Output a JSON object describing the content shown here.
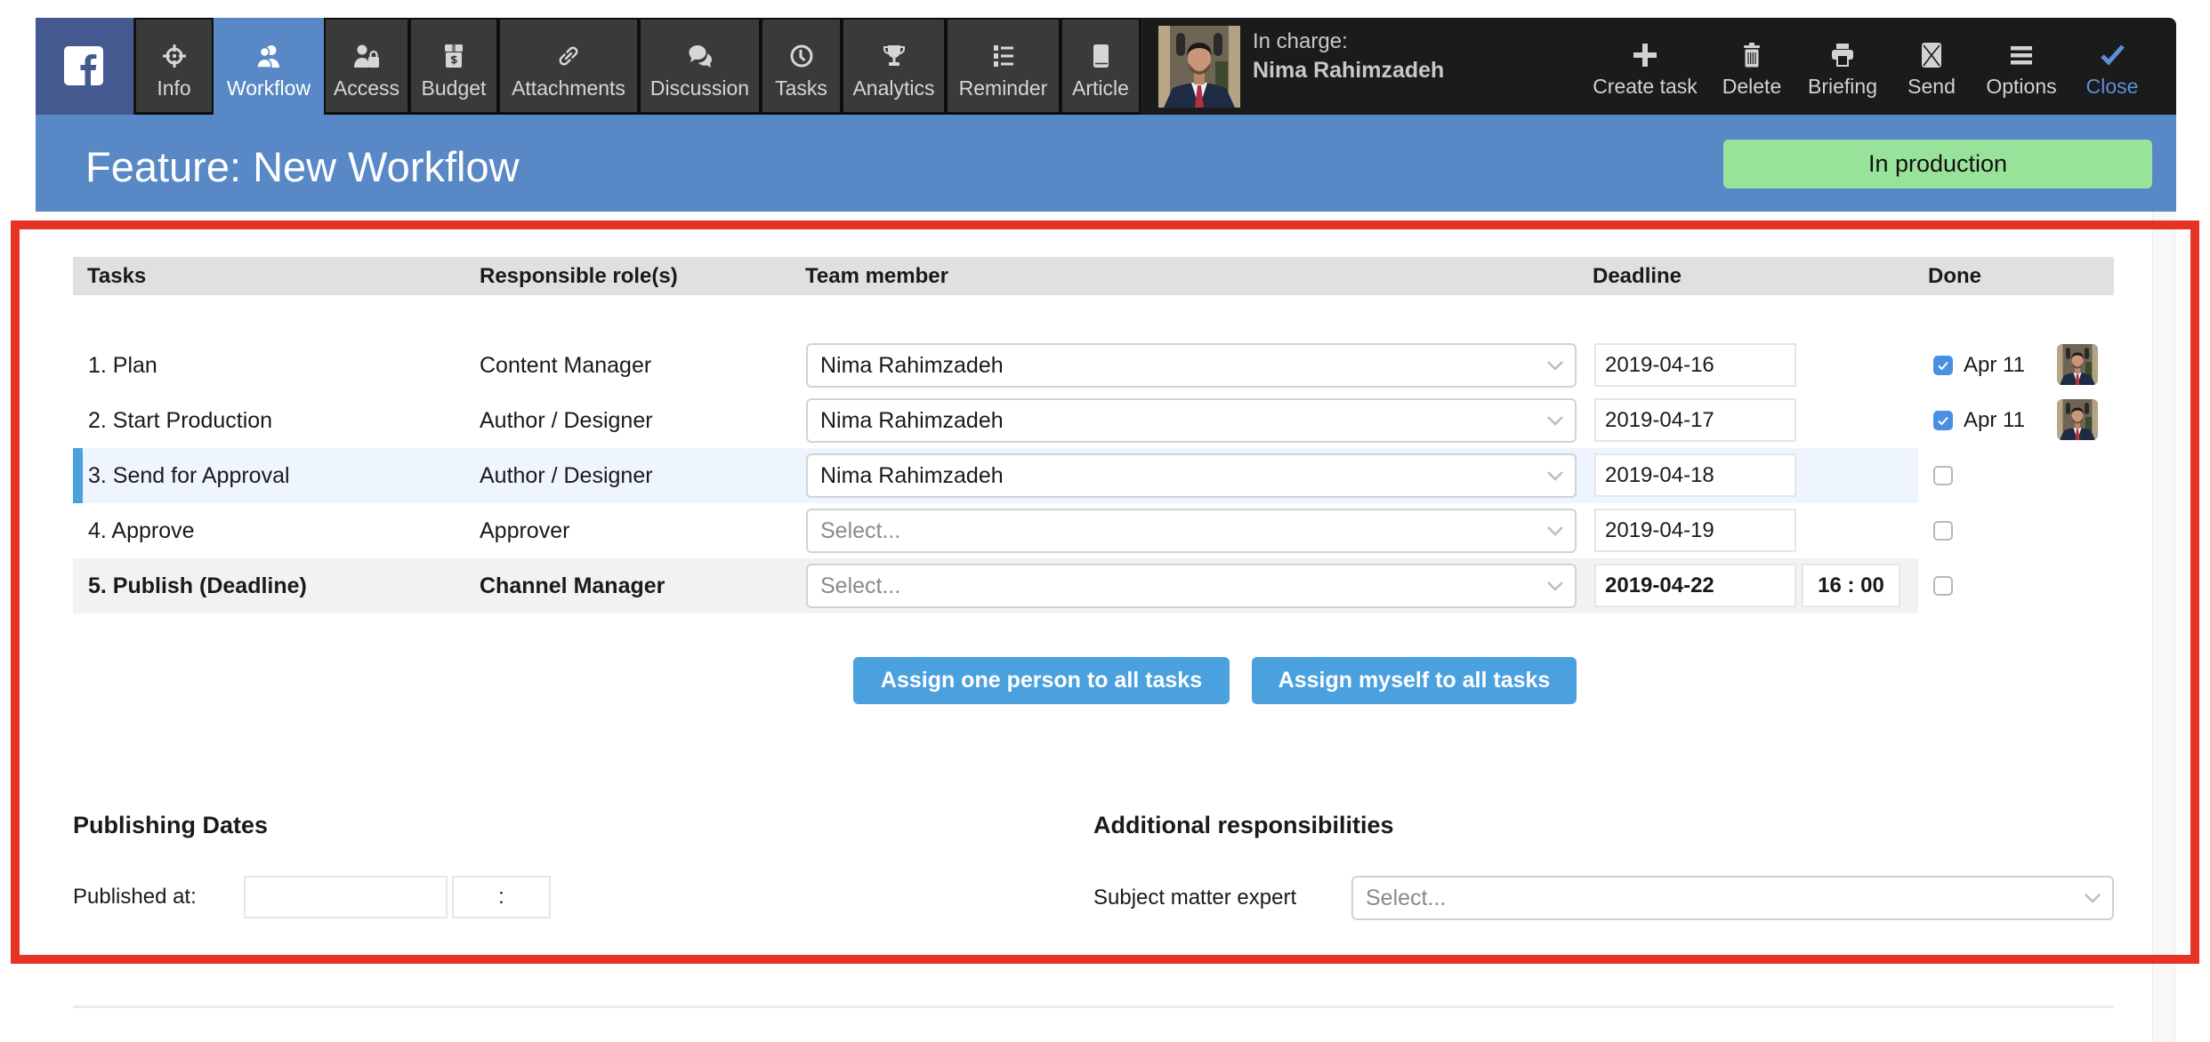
{
  "colors": {
    "brand": "#44598f",
    "toolbar": "#1b1b1b",
    "accent": "#5889c6",
    "status": "#98e39a",
    "button": "#4ba0de",
    "close": "#5b8fd6",
    "annotation": "#e63323"
  },
  "toolbar": {
    "brand_icon": "facebook-icon",
    "tabs": [
      {
        "label": "Info",
        "icon": "target-icon",
        "active": false
      },
      {
        "label": "Workflow",
        "icon": "users-icon",
        "active": true
      },
      {
        "label": "Access",
        "icon": "user-lock-icon",
        "active": false
      },
      {
        "label": "Budget",
        "icon": "money-box-icon",
        "active": false
      },
      {
        "label": "Attachments",
        "icon": "link-icon",
        "active": false
      },
      {
        "label": "Discussion",
        "icon": "comments-icon",
        "active": false
      },
      {
        "label": "Tasks",
        "icon": "clock-icon",
        "active": false
      },
      {
        "label": "Analytics",
        "icon": "trophy-icon",
        "active": false
      },
      {
        "label": "Reminder",
        "icon": "list-icon",
        "active": false
      },
      {
        "label": "Article",
        "icon": "book-icon",
        "active": false
      }
    ],
    "in_charge": {
      "label": "In charge:",
      "name": "Nima Rahimzadeh"
    },
    "actions": [
      {
        "label": "Create task",
        "icon": "plus-icon"
      },
      {
        "label": "Delete",
        "icon": "trash-icon"
      },
      {
        "label": "Briefing",
        "icon": "printer-icon"
      },
      {
        "label": "Send",
        "icon": "envelope-icon"
      },
      {
        "label": "Options",
        "icon": "menu-icon"
      },
      {
        "label": "Close",
        "icon": "check-icon"
      }
    ]
  },
  "header": {
    "title": "Feature: New Workflow",
    "status": "In production"
  },
  "tasks_table": {
    "columns": [
      "Tasks",
      "Responsible role(s)",
      "Team member",
      "Deadline",
      "Done"
    ],
    "member_placeholder": "Select...",
    "rows": [
      {
        "task": "1. Plan",
        "role": "Content Manager",
        "team_member": "Nima Rahimzadeh",
        "deadline": "2019-04-16",
        "deadline_time": null,
        "done": true,
        "done_date": "Apr 11",
        "current": false,
        "emphasized": false
      },
      {
        "task": "2. Start Production",
        "role": "Author / Designer",
        "team_member": "Nima Rahimzadeh",
        "deadline": "2019-04-17",
        "deadline_time": null,
        "done": true,
        "done_date": "Apr 11",
        "current": false,
        "emphasized": false
      },
      {
        "task": "3. Send for Approval",
        "role": "Author / Designer",
        "team_member": "Nima Rahimzadeh",
        "deadline": "2019-04-18",
        "deadline_time": null,
        "done": false,
        "done_date": null,
        "current": true,
        "emphasized": false
      },
      {
        "task": "4. Approve",
        "role": "Approver",
        "team_member": "",
        "deadline": "2019-04-19",
        "deadline_time": null,
        "done": false,
        "done_date": null,
        "current": false,
        "emphasized": false
      },
      {
        "task": "5. Publish (Deadline)",
        "role": "Channel Manager",
        "team_member": "",
        "deadline": "2019-04-22",
        "deadline_time": "16 : 00",
        "done": false,
        "done_date": null,
        "current": false,
        "emphasized": true
      }
    ]
  },
  "bulk_actions": {
    "assign_one": "Assign one person to all tasks",
    "assign_myself": "Assign myself to all tasks"
  },
  "publishing": {
    "title": "Publishing Dates",
    "published_at_label": "Published at:",
    "date": "",
    "time_separator": ":"
  },
  "additional": {
    "title": "Additional responsibilities",
    "sme_label": "Subject matter expert",
    "sme_value": "",
    "sme_placeholder": "Select..."
  }
}
